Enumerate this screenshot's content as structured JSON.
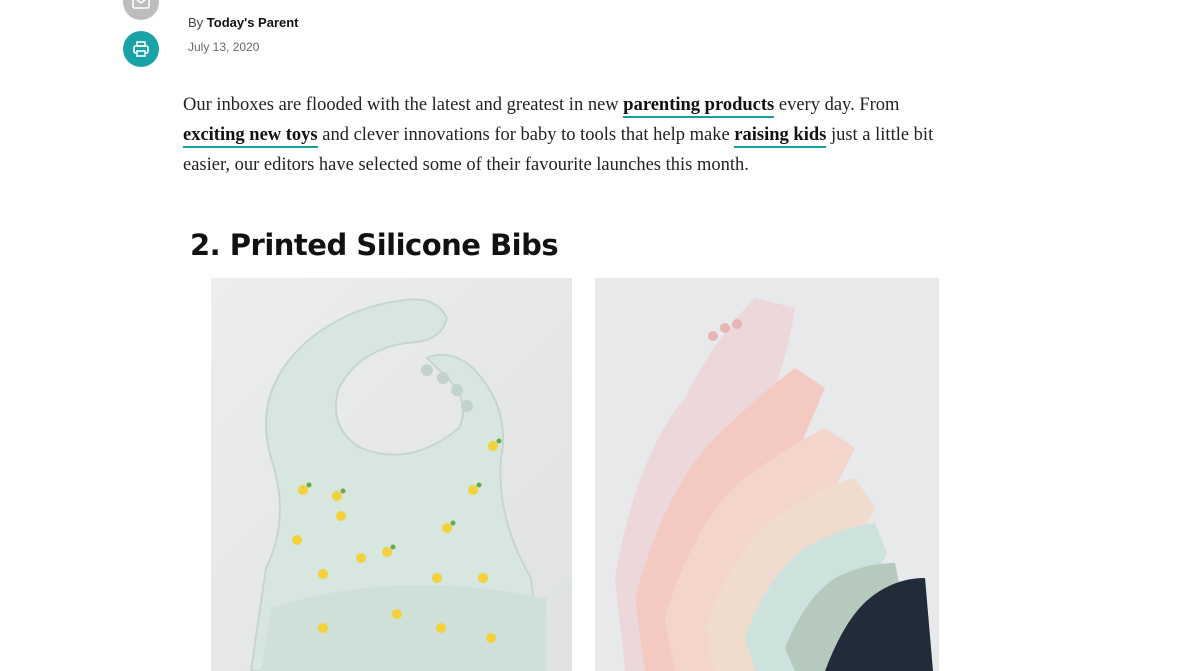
{
  "share": {
    "mail_icon": "mail-icon",
    "print_icon": "printer-icon"
  },
  "byline": {
    "prefix": "By",
    "author": "Today's Parent",
    "date": "July 13, 2020"
  },
  "intro": {
    "t1": "Our inboxes are flooded with the latest and greatest in new ",
    "link1": "parenting products",
    "t2": " every day. From ",
    "link2": "exciting new toys",
    "t3": " and clever innovations for baby to tools that help make ",
    "link3": "raising kids",
    "t4": " just a little bit easier, our editors have selected some of their favourite launches this month."
  },
  "section": {
    "heading": "2. Printed Silicone Bibs"
  },
  "images": {
    "left": "mint silicone bib with lemon print",
    "right": "stack of colourful printed silicone bibs"
  },
  "colors": {
    "accent": "#1aa3a7",
    "mail_bg": "#bdbdbd",
    "link_underline": "#1a9c9f"
  }
}
